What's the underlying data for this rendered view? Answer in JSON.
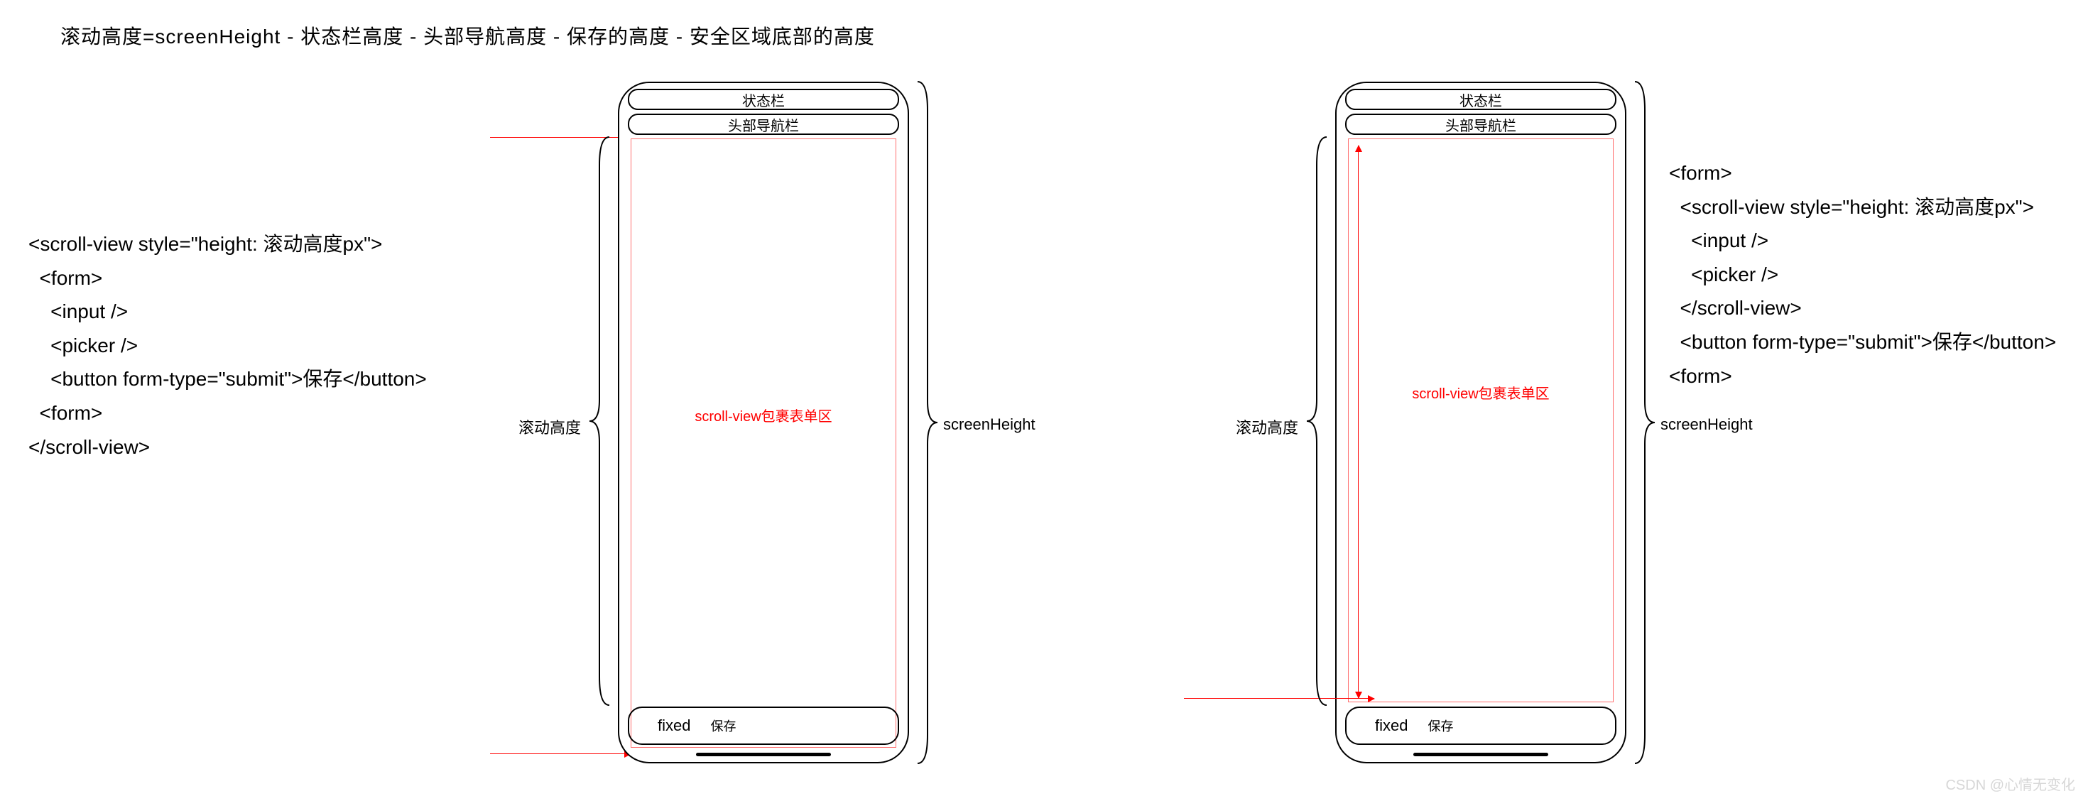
{
  "title": "滚动高度=screenHeight - 状态栏高度 - 头部导航高度 - 保存的高度 - 安全区域底部的高度",
  "left_code": "<scroll-view style=\"height: 滚动高度px\">\n  <form>\n    <input />\n    <picker />\n    <button form-type=\"submit\">保存</button>\n  <form>\n</scroll-view>",
  "right_code": "<form>\n  <scroll-view style=\"height: 滚动高度px\">\n    <input />\n    <picker />\n  </scroll-view>\n  <button form-type=\"submit\">保存</button>\n<form>",
  "phone": {
    "status_bar": "状态栏",
    "nav_bar": "头部导航栏",
    "scroll_label": "scroll-view包裹表单区",
    "fixed": "fixed",
    "save": "保存"
  },
  "brace_labels": {
    "scroll_height": "滚动高度",
    "screen_height": "screenHeight"
  },
  "watermark": "CSDN @心情无变化"
}
